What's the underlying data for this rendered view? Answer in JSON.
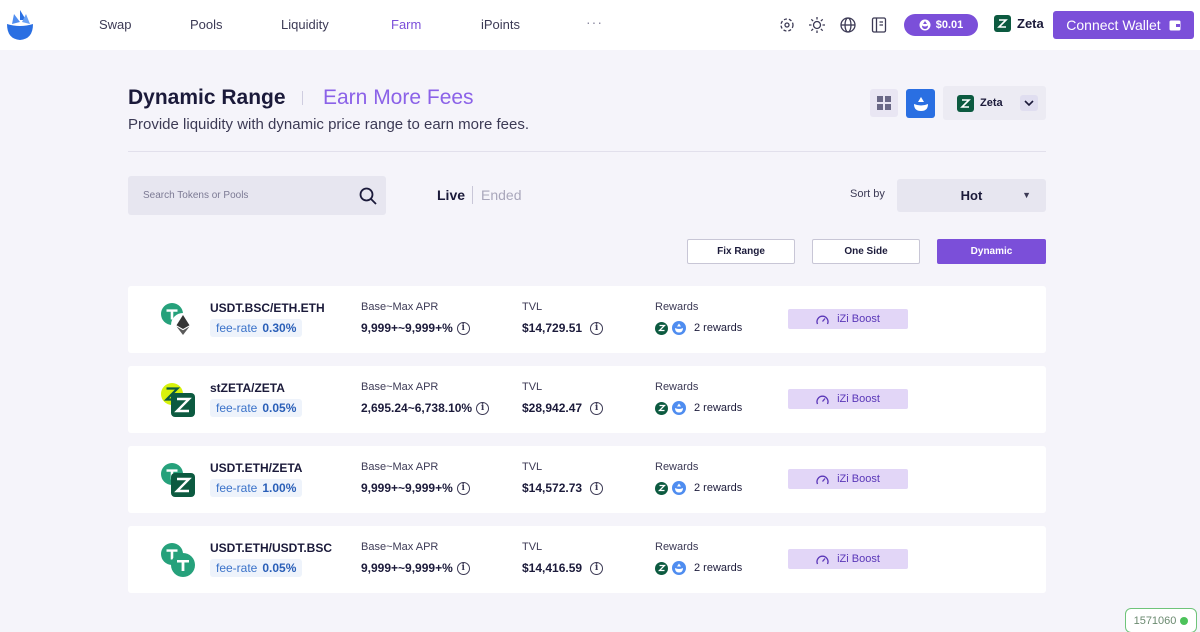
{
  "nav": {
    "links": [
      {
        "label": "Swap",
        "active": false
      },
      {
        "label": "Pools",
        "active": false
      },
      {
        "label": "Liquidity",
        "active": false
      },
      {
        "label": "Farm",
        "active": true
      },
      {
        "label": "iPoints",
        "active": false
      }
    ],
    "more": "···",
    "icons": [
      "network-icon",
      "sun-icon",
      "globe-icon",
      "book-icon"
    ],
    "price": "$0.01",
    "chain": "Zeta",
    "connect_label": "Connect Wallet"
  },
  "page": {
    "title": "Dynamic Range",
    "subtitle": "Earn More Fees",
    "description": "Provide liquidity with dynamic price range to earn more fees.",
    "chain_select": "Zeta"
  },
  "filters": {
    "search_placeholder": "Search Tokens or Pools",
    "tab_live": "Live",
    "tab_ended": "Ended",
    "sort_label": "Sort by",
    "sort_value": "Hot",
    "range_buttons": [
      {
        "label": "Fix Range",
        "active": false
      },
      {
        "label": "One Side",
        "active": false
      },
      {
        "label": "Dynamic",
        "active": true
      }
    ]
  },
  "farms": [
    {
      "pair": "USDT.BSC/ETH.ETH",
      "fee_label": "fee-rate",
      "fee": "0.30%",
      "apr_label": "Base~Max APR",
      "apr": "9,999+~9,999+%",
      "tvl_label": "TVL",
      "tvl": "$14,729.51",
      "rewards_label": "Rewards",
      "rewards": "2 rewards",
      "boost": "iZi Boost",
      "token_a": "usdt",
      "token_b": "eth"
    },
    {
      "pair": "stZETA/ZETA",
      "fee_label": "fee-rate",
      "fee": "0.05%",
      "apr_label": "Base~Max APR",
      "apr": "2,695.24~6,738.10%",
      "tvl_label": "TVL",
      "tvl": "$28,942.47",
      "rewards_label": "Rewards",
      "rewards": "2 rewards",
      "boost": "iZi Boost",
      "token_a": "stzeta",
      "token_b": "zeta"
    },
    {
      "pair": "USDT.ETH/ZETA",
      "fee_label": "fee-rate",
      "fee": "1.00%",
      "apr_label": "Base~Max APR",
      "apr": "9,999+~9,999+%",
      "tvl_label": "TVL",
      "tvl": "$14,572.73",
      "rewards_label": "Rewards",
      "rewards": "2 rewards",
      "boost": "iZi Boost",
      "token_a": "usdt",
      "token_b": "zeta"
    },
    {
      "pair": "USDT.ETH/USDT.BSC",
      "fee_label": "fee-rate",
      "fee": "0.05%",
      "apr_label": "Base~Max APR",
      "apr": "9,999+~9,999+%",
      "tvl_label": "TVL",
      "tvl": "$14,416.59",
      "rewards_label": "Rewards",
      "rewards": "2 rewards",
      "boost": "iZi Boost",
      "token_a": "usdt",
      "token_b": "usdt"
    }
  ],
  "block_number": "1571060",
  "colors": {
    "accent": "#7b4fd9",
    "zeta_green": "#0c5a40",
    "usdt_green": "#26a17b",
    "izi_blue": "#2a6fe2"
  }
}
